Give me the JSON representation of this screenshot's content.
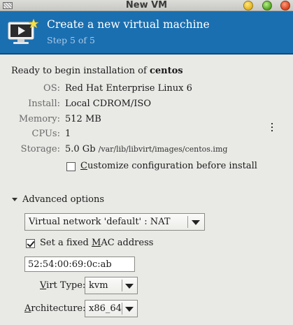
{
  "window": {
    "title": "New VM"
  },
  "header": {
    "title": "Create a new virtual machine",
    "step": "Step 5 of 5",
    "icon": "monitor-play-icon"
  },
  "summary": {
    "ready_prefix": "Ready to begin installation of ",
    "vm_name": "centos",
    "rows": [
      {
        "label": "OS:",
        "value": "Red Hat Enterprise Linux 6"
      },
      {
        "label": "Install:",
        "value": "Local CDROM/ISO"
      },
      {
        "label": "Memory:",
        "value": "512 MB"
      },
      {
        "label": "CPUs:",
        "value": "1"
      },
      {
        "label": "Storage:",
        "value": "5.0 Gb",
        "path": "/var/lib/libvirt/images/centos.img"
      }
    ]
  },
  "customize": {
    "label_pre": "",
    "label_mnemonic": "C",
    "label_rest": "ustomize configuration before install",
    "checked": false
  },
  "advanced": {
    "label": "Advanced options",
    "expanded": true,
    "network": {
      "selected": "Virtual network 'default' : NAT"
    },
    "mac": {
      "label_pre": "Set a fixed ",
      "label_mnemonic": "M",
      "label_rest": "AC address",
      "checked": true,
      "value": "52:54:00:69:0c:ab"
    },
    "virt_type": {
      "label_mnemonic": "V",
      "label_rest": "irt Type:",
      "selected": "kvm"
    },
    "architecture": {
      "label_mnemonic": "A",
      "label_rest": "rchitecture:",
      "selected": "x86_64"
    }
  },
  "colors": {
    "banner": "#1a6fb0",
    "banner_step": "#a9c9e8",
    "window_bg": "#e9e9e6"
  }
}
